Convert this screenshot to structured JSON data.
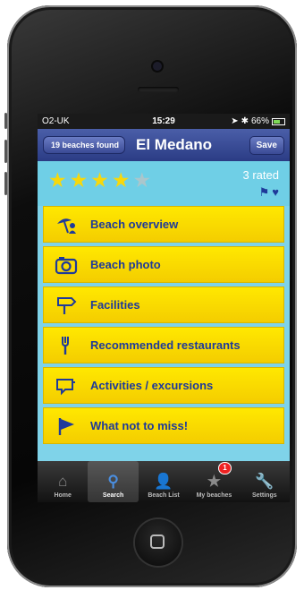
{
  "status": {
    "carrier": "O2-UK",
    "time": "15:29",
    "battery": "66%"
  },
  "nav": {
    "back_label": "19 beaches found",
    "title": "El Medano",
    "save_label": "Save"
  },
  "rating": {
    "stars_filled": 4,
    "stars_total": 5,
    "rated_text": "3 rated",
    "icons": [
      "flag-icon",
      "heart-icon"
    ]
  },
  "menu": [
    {
      "label": "Beach overview",
      "icon": "beach-umbrella-icon"
    },
    {
      "label": "Beach photo",
      "icon": "camera-icon"
    },
    {
      "label": "Facilities",
      "icon": "signpost-icon"
    },
    {
      "label": "Recommended restaurants",
      "icon": "fork-icon"
    },
    {
      "label": "Activities / excursions",
      "icon": "speech-bubble-icon"
    },
    {
      "label": "What not to miss!",
      "icon": "flag-icon"
    }
  ],
  "tabs": [
    {
      "label": "Home",
      "icon": "home-icon",
      "active": false
    },
    {
      "label": "Search",
      "icon": "search-icon",
      "active": true
    },
    {
      "label": "Beach List",
      "icon": "person-icon",
      "active": false
    },
    {
      "label": "My beaches",
      "icon": "star-person-icon",
      "active": false,
      "badge": "1"
    },
    {
      "label": "Settings",
      "icon": "wrench-icon",
      "active": false
    }
  ],
  "colors": {
    "accent_yellow": "#f8d80a",
    "nav_blue": "#2b3c85",
    "screen_bg": "#7fd3e9",
    "label_blue": "#1e3a9a"
  }
}
